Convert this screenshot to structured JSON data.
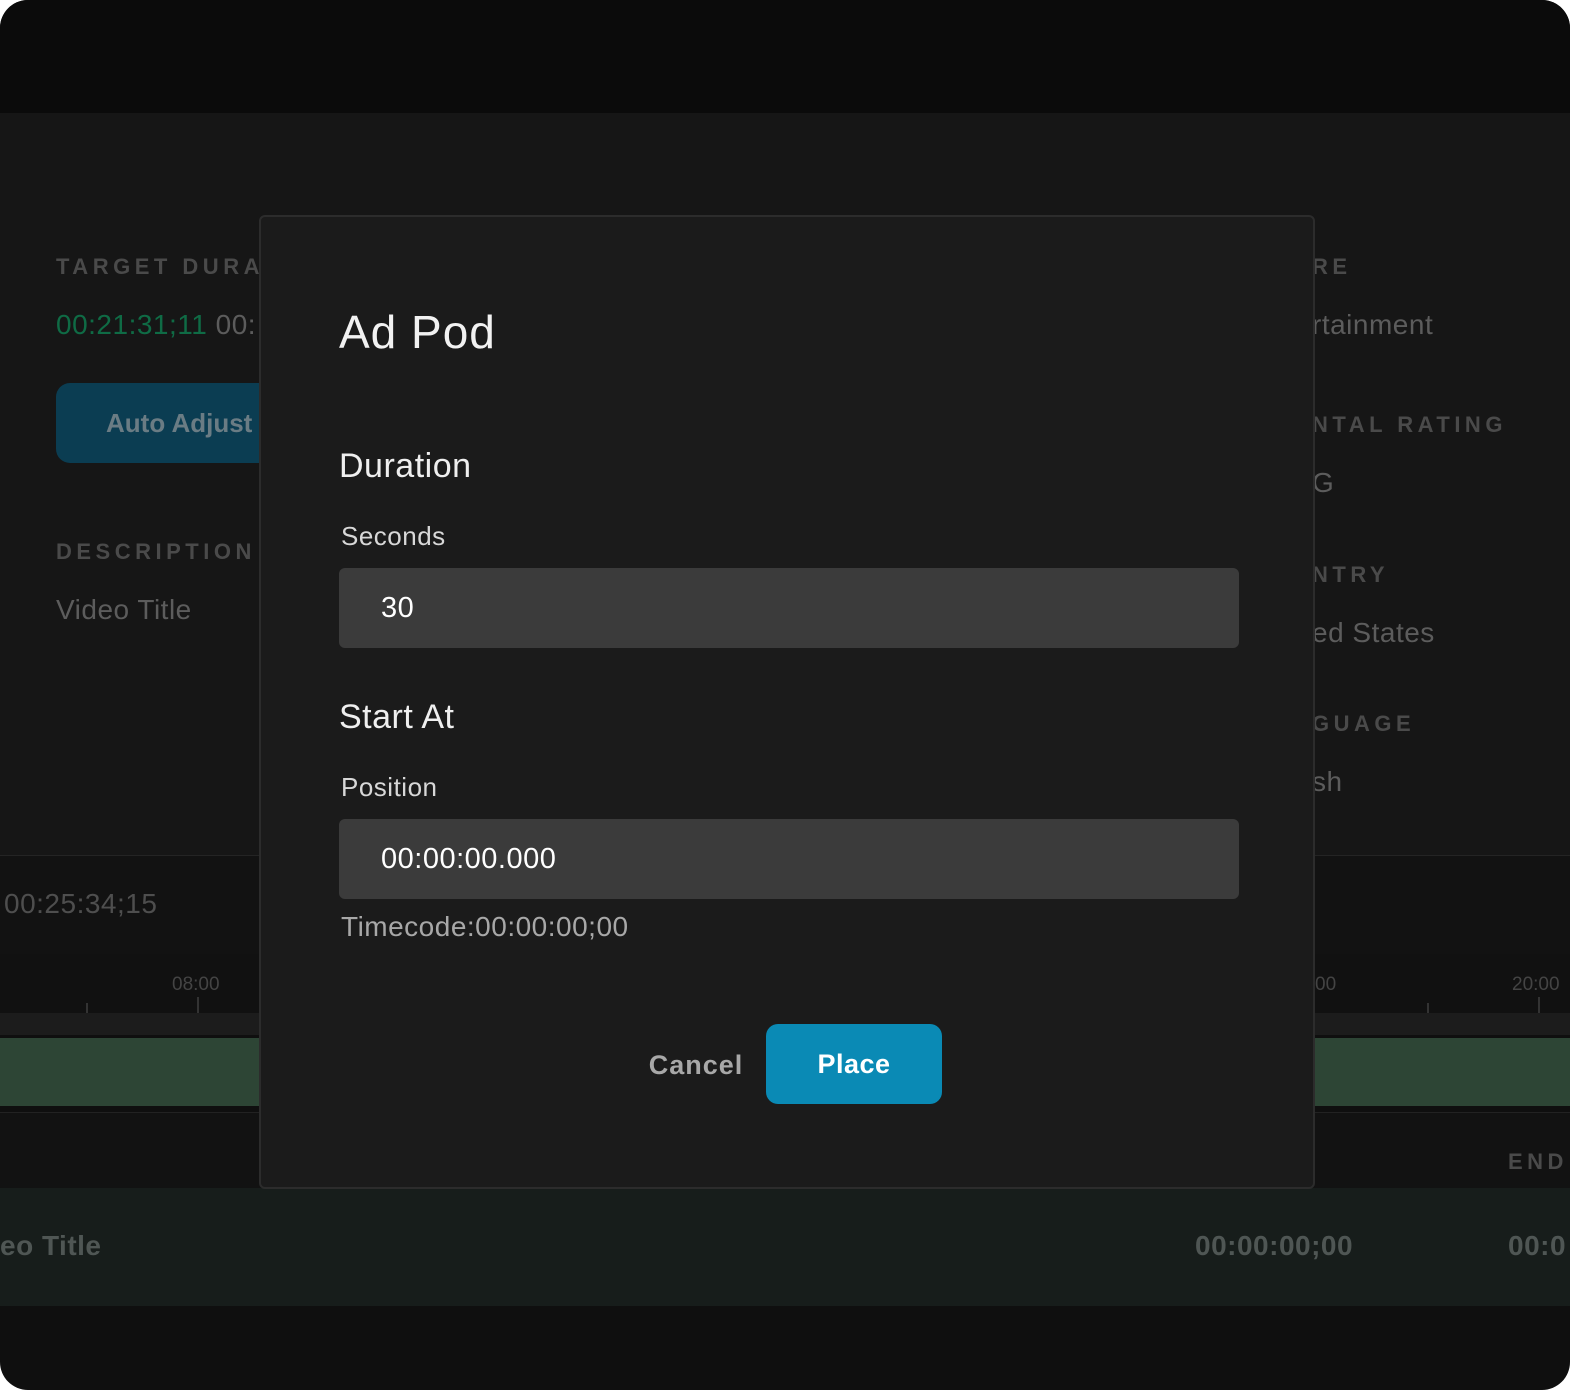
{
  "background": {
    "target_duration_label": "TARGET DURA",
    "target_duration_value": "00:21:31;11",
    "target_duration_value_2": "00:",
    "auto_adjust_label": "Auto Adjust",
    "description_label": "DESCRIPTION",
    "description_value": "Video Title",
    "genre_label": "RE",
    "genre_value": "rtainment",
    "rating_label": "NTAL RATING",
    "rating_value": "G",
    "country_label": "NTRY",
    "country_value": "ed States",
    "language_label": "GUAGE",
    "language_value": "sh",
    "total_timecode": "00:25:34;15",
    "ruler_labels": [
      "08:00",
      "00",
      "20:00"
    ],
    "list_end_header": "END",
    "row_title": "eo Title",
    "row_start": "00:00:00;00",
    "row_end": "00:0"
  },
  "modal": {
    "title": "Ad Pod",
    "duration_heading": "Duration",
    "seconds_label": "Seconds",
    "seconds_value": "30",
    "start_heading": "Start At",
    "position_label": "Position",
    "position_value": "00:00:00.000",
    "timecode_text": "Timecode:00:00:00;00",
    "cancel_label": "Cancel",
    "place_label": "Place"
  },
  "colors": {
    "accent": "#0a8ab5",
    "green_timecode": "#0f6b45",
    "track_green": "#2d4535"
  }
}
